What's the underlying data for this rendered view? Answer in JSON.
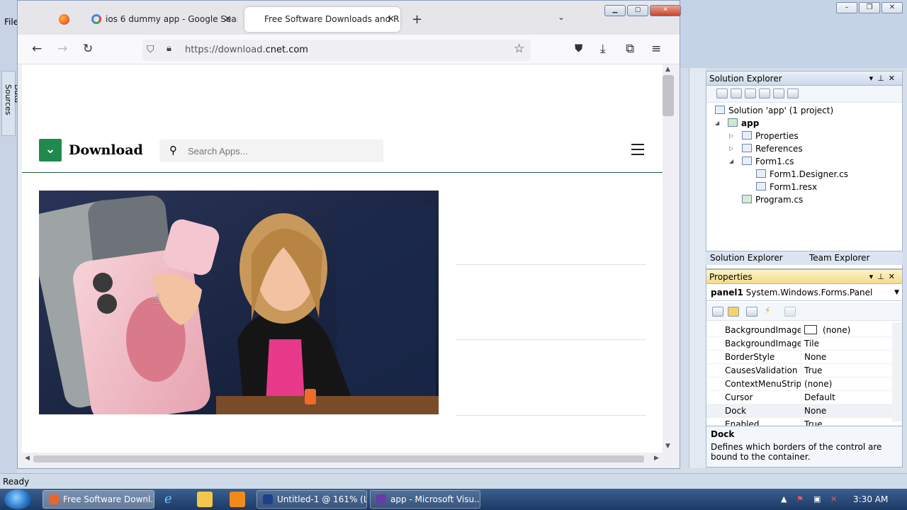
{
  "vs": {
    "menu_file": "File",
    "data_sources": "Data Sources",
    "status": "Ready"
  },
  "browser": {
    "tabs": [
      {
        "label": "",
        "icon": "firefox-icon"
      },
      {
        "label": "ios 6 dummy app - Google Sear",
        "icon": "google-icon"
      },
      {
        "label": "Free Software Downloads and R",
        "icon": "none"
      }
    ],
    "new_tab": "+",
    "tab_list": "⌄",
    "url": {
      "prefix": "https://download.",
      "domain": "cnet.com"
    }
  },
  "page": {
    "logo_text": "Download",
    "search_placeholder": "Search Apps..."
  },
  "solution_explorer": {
    "title": "Solution Explorer",
    "items": [
      {
        "label": "Solution 'app' (1 project)"
      },
      {
        "label": "app"
      },
      {
        "label": "Properties"
      },
      {
        "label": "References"
      },
      {
        "label": "Form1.cs"
      },
      {
        "label": "Form1.Designer.cs"
      },
      {
        "label": "Form1.resx"
      },
      {
        "label": "Program.cs"
      }
    ],
    "tabs": [
      "Solution Explorer",
      "Team Explorer"
    ]
  },
  "properties": {
    "title": "Properties",
    "object_name": "panel1",
    "object_type": "System.Windows.Forms.Panel",
    "rows": [
      {
        "key": "BackgroundImage",
        "value": "(none)"
      },
      {
        "key": "BackgroundImageLa",
        "value": "Tile"
      },
      {
        "key": "BorderStyle",
        "value": "None"
      },
      {
        "key": "CausesValidation",
        "value": "True"
      },
      {
        "key": "ContextMenuStrip",
        "value": "(none)"
      },
      {
        "key": "Cursor",
        "value": "Default"
      },
      {
        "key": "Dock",
        "value": "None"
      },
      {
        "key": "Enabled",
        "value": "True"
      }
    ],
    "desc_title": "Dock",
    "desc_text": "Defines which borders of the control are bound to the container."
  },
  "taskbar": {
    "items": [
      {
        "label": "Free Software Downl...",
        "icon_color": "#e8662b"
      },
      {
        "label": "Untitled-1 @ 161% (L...",
        "icon_color": "#1d3f8c"
      },
      {
        "label": "app - Microsoft Visu...",
        "icon_color": "#6a3aa8"
      }
    ],
    "clock": "3:30 AM"
  },
  "colors": {
    "cnet_green": "#1f8a4c",
    "vs_blue": "#c5d3e6"
  }
}
